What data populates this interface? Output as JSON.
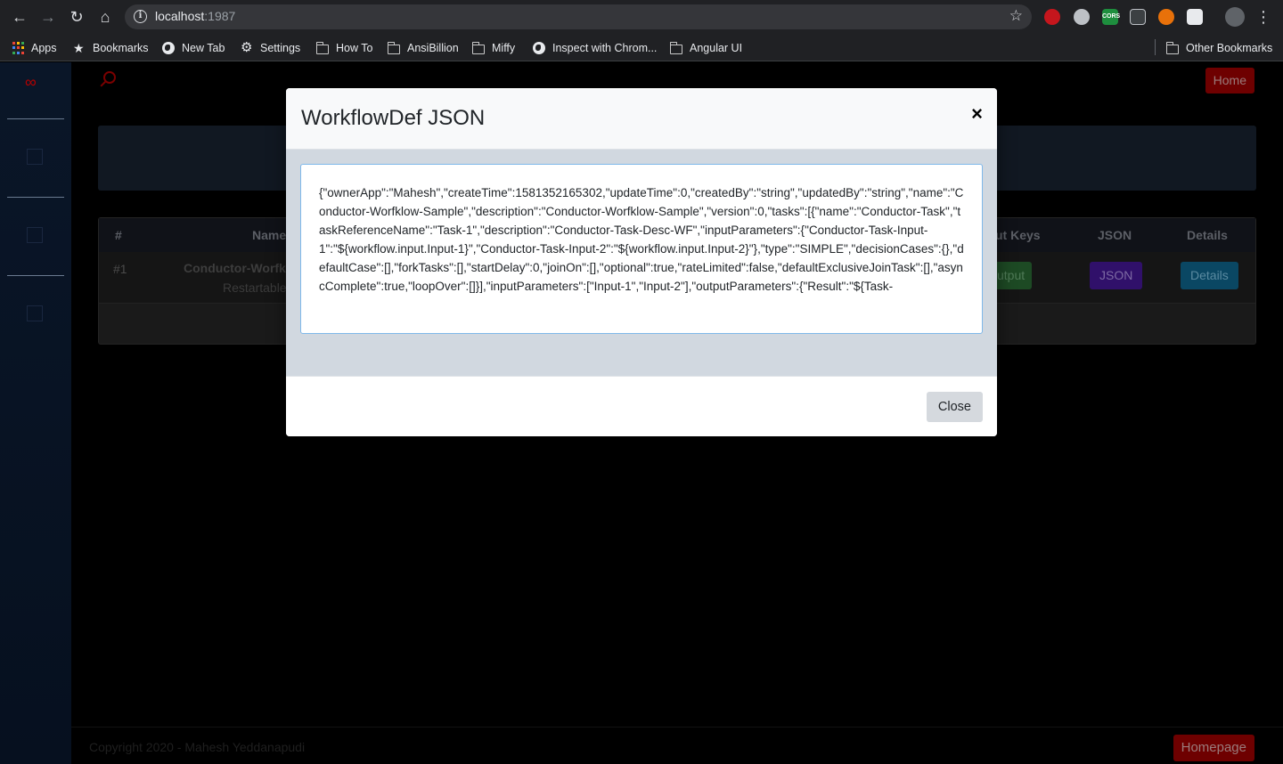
{
  "browser": {
    "url_host": "localhost",
    "url_port": ":1987",
    "bookmarks": [
      {
        "label": "Apps",
        "icon": "apps-icon"
      },
      {
        "label": "Bookmarks",
        "icon": "star-icon"
      },
      {
        "label": "New Tab",
        "icon": "globe-icon"
      },
      {
        "label": "Settings",
        "icon": "gear-icon"
      },
      {
        "label": "How To",
        "icon": "folder-icon"
      },
      {
        "label": "AnsiBillion",
        "icon": "folder-icon"
      },
      {
        "label": "Miffy",
        "icon": "folder-icon"
      },
      {
        "label": "Inspect with Chrom...",
        "icon": "globe-icon"
      },
      {
        "label": "Angular UI",
        "icon": "folder-icon"
      }
    ],
    "other_bookmarks": "Other Bookmarks"
  },
  "app": {
    "home_label": "Home",
    "table": {
      "headers": {
        "num": "#",
        "name": "Name",
        "output_keys": "ut Keys",
        "json": "JSON",
        "details": "Details"
      },
      "row": {
        "num": "#1",
        "name": "Conductor-Worfk",
        "sub": "Restartable",
        "output_btn": "utput",
        "json_btn": "JSON",
        "details_btn": "Details"
      }
    },
    "footer": {
      "copyright": "Copyright 2020 - Mahesh Yeddanapudi",
      "homepage_label": "Homepage"
    },
    "colors": {
      "accent_red": "#b50000",
      "json_btn": "#5a17b5",
      "details_btn": "#0d84b8",
      "output_btn": "#2f8a3e"
    }
  },
  "modal": {
    "title": "WorkflowDef JSON",
    "close_x": "×",
    "json_text": "{\"ownerApp\":\"Mahesh\",\"createTime\":1581352165302,\"updateTime\":0,\"createdBy\":\"string\",\"updatedBy\":\"string\",\"name\":\"Conductor-Worfklow-Sample\",\"description\":\"Conductor-Worfklow-Sample\",\"version\":0,\"tasks\":[{\"name\":\"Conductor-Task\",\"taskReferenceName\":\"Task-1\",\"description\":\"Conductor-Task-Desc-WF\",\"inputParameters\":{\"Conductor-Task-Input-1\":\"${workflow.input.Input-1}\",\"Conductor-Task-Input-2\":\"${workflow.input.Input-2}\"},\"type\":\"SIMPLE\",\"decisionCases\":{},\"defaultCase\":[],\"forkTasks\":[],\"startDelay\":0,\"joinOn\":[],\"optional\":true,\"rateLimited\":false,\"defaultExclusiveJoinTask\":[],\"asyncComplete\":true,\"loopOver\":[]}],\"inputParameters\":[\"Input-1\",\"Input-2\"],\"outputParameters\":{\"Result\":\"${Task-",
    "close_label": "Close"
  }
}
